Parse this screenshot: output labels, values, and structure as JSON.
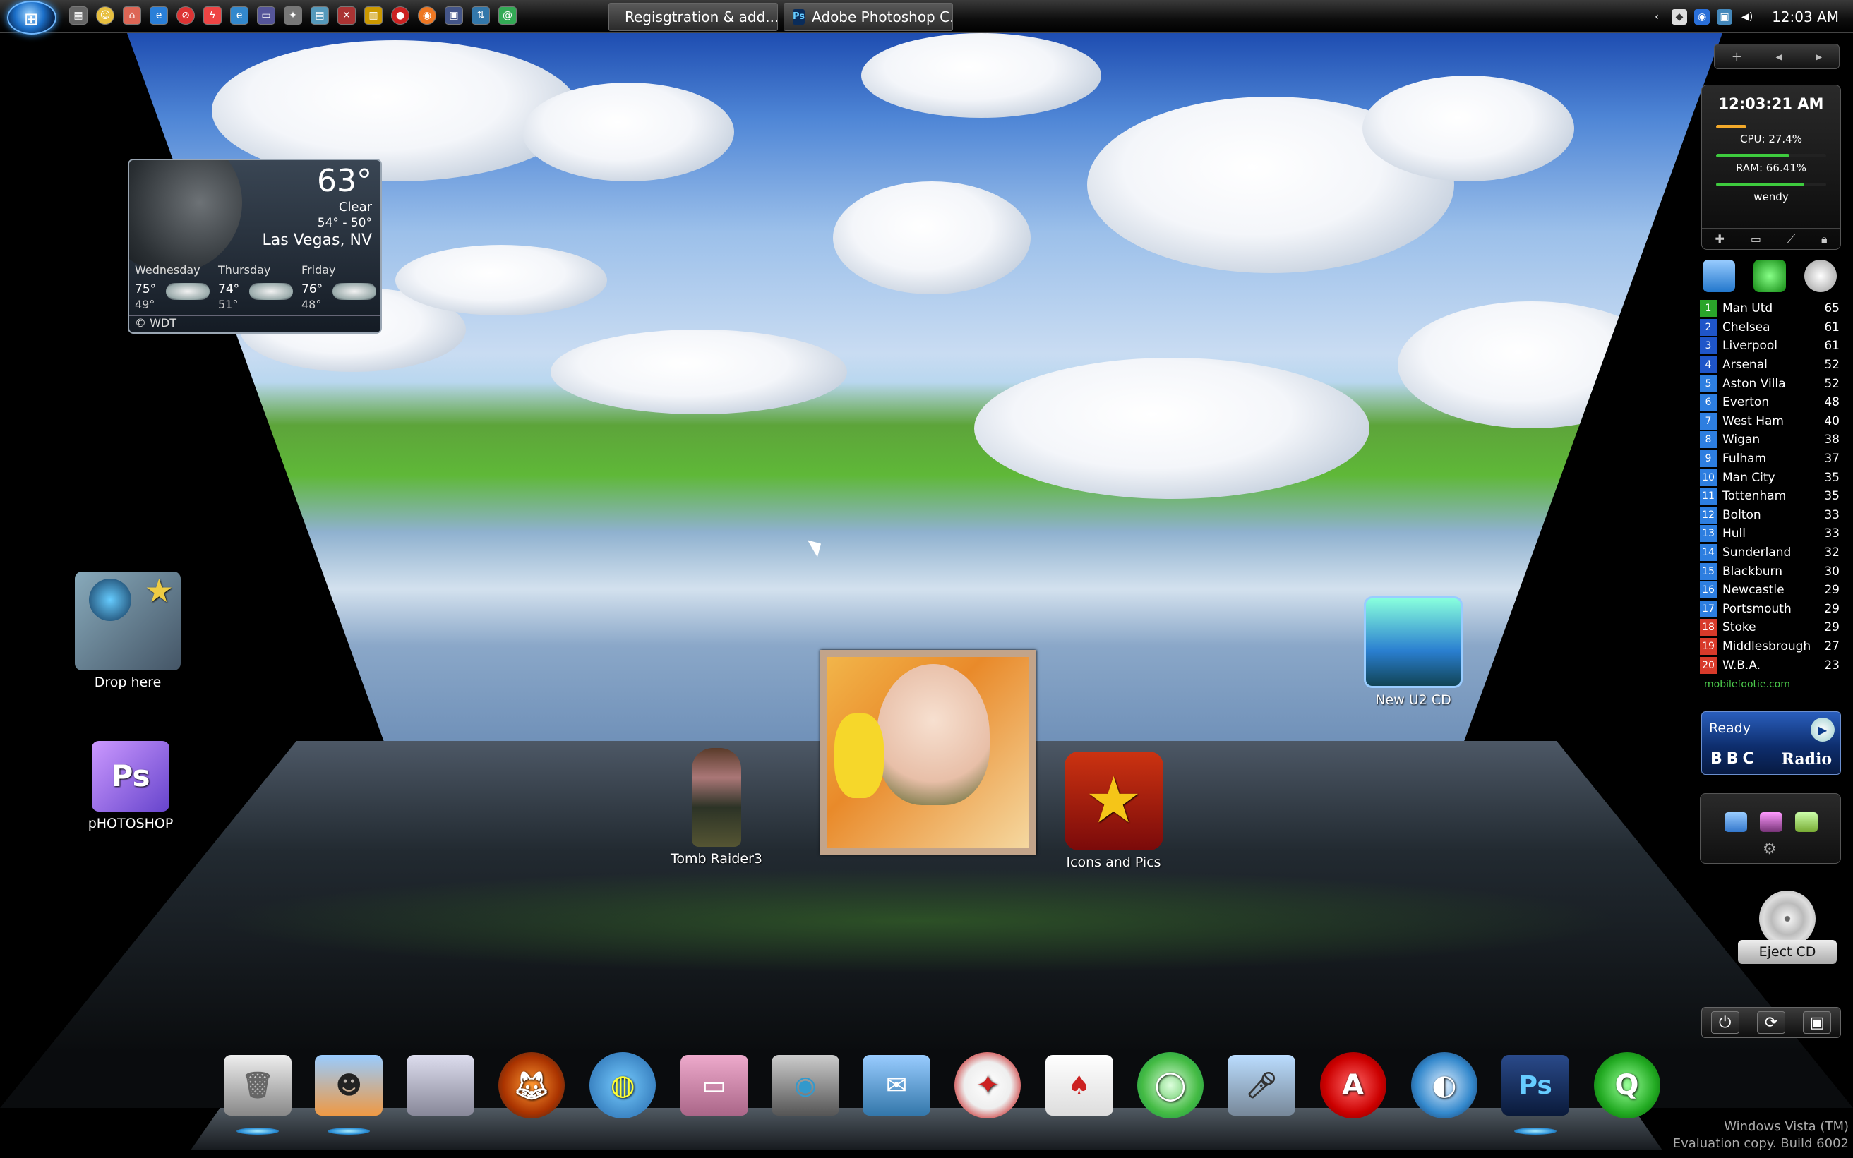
{
  "taskbar": {
    "tasks": [
      {
        "label": "Regisgtration & add...",
        "icon": "document-icon"
      },
      {
        "label": "Adobe Photoshop C...",
        "icon": "photoshop-icon"
      }
    ],
    "clock": "12:03 AM"
  },
  "weather": {
    "temp": "63°",
    "condition": "Clear",
    "range": "54° - 50°",
    "city": "Las Vegas, NV",
    "days": [
      {
        "name": "Wednesday",
        "hi": "75°",
        "lo": "49°"
      },
      {
        "name": "Thursday",
        "hi": "74°",
        "lo": "51°"
      },
      {
        "name": "Friday",
        "hi": "76°",
        "lo": "48°"
      }
    ],
    "credit": "© WDT"
  },
  "desktop_icons": {
    "drop_here": "Drop here",
    "photoshop": "pHOTOSHOP",
    "tomb_raider": "Tomb Raider3",
    "icons_pics": "Icons and Pics",
    "new_u2": "New U2 CD"
  },
  "sysmon": {
    "time": "12:03:21 AM",
    "cpu": "CPU: 27.4%",
    "cpu_fraction": 0.274,
    "ram": "RAM: 66.41%",
    "ram_fraction": 0.6641,
    "user": "wendy"
  },
  "league": {
    "rows": [
      {
        "pos": "1",
        "team": "Man Utd",
        "pts": "65",
        "color": "#2aa52a"
      },
      {
        "pos": "2",
        "team": "Chelsea",
        "pts": "61",
        "color": "#1f55c9"
      },
      {
        "pos": "3",
        "team": "Liverpool",
        "pts": "61",
        "color": "#1f55c9"
      },
      {
        "pos": "4",
        "team": "Arsenal",
        "pts": "52",
        "color": "#1f55c9"
      },
      {
        "pos": "5",
        "team": "Aston Villa",
        "pts": "52",
        "color": "#2d7ee0"
      },
      {
        "pos": "6",
        "team": "Everton",
        "pts": "48",
        "color": "#2d7ee0"
      },
      {
        "pos": "7",
        "team": "West Ham",
        "pts": "40",
        "color": "#2d7ee0"
      },
      {
        "pos": "8",
        "team": "Wigan",
        "pts": "38",
        "color": "#2d7ee0"
      },
      {
        "pos": "9",
        "team": "Fulham",
        "pts": "37",
        "color": "#2d7ee0"
      },
      {
        "pos": "10",
        "team": "Man City",
        "pts": "35",
        "color": "#2d7ee0"
      },
      {
        "pos": "11",
        "team": "Tottenham",
        "pts": "35",
        "color": "#2d7ee0"
      },
      {
        "pos": "12",
        "team": "Bolton",
        "pts": "33",
        "color": "#2d7ee0"
      },
      {
        "pos": "13",
        "team": "Hull",
        "pts": "33",
        "color": "#2d7ee0"
      },
      {
        "pos": "14",
        "team": "Sunderland",
        "pts": "32",
        "color": "#2d7ee0"
      },
      {
        "pos": "15",
        "team": "Blackburn",
        "pts": "30",
        "color": "#2d7ee0"
      },
      {
        "pos": "16",
        "team": "Newcastle",
        "pts": "29",
        "color": "#2d7ee0"
      },
      {
        "pos": "17",
        "team": "Portsmouth",
        "pts": "29",
        "color": "#2d7ee0"
      },
      {
        "pos": "18",
        "team": "Stoke",
        "pts": "29",
        "color": "#d83a2a"
      },
      {
        "pos": "19",
        "team": "Middlesbrough",
        "pts": "27",
        "color": "#d83a2a"
      },
      {
        "pos": "20",
        "team": "W.B.A.",
        "pts": "23",
        "color": "#d83a2a"
      }
    ],
    "credit": "mobilefootie.com"
  },
  "radio": {
    "status": "Ready",
    "brand": "BBC",
    "label": "Radio"
  },
  "eject": {
    "label": "Eject CD"
  },
  "dock": [
    {
      "name": "trash-icon"
    },
    {
      "name": "finder-icon"
    },
    {
      "name": "mac-monitor-icon"
    },
    {
      "name": "firefox-icon"
    },
    {
      "name": "simpsons-globe-icon"
    },
    {
      "name": "wallet-icon"
    },
    {
      "name": "eye-camera-icon"
    },
    {
      "name": "stamp-icon"
    },
    {
      "name": "flame-app-icon"
    },
    {
      "name": "cards-icon"
    },
    {
      "name": "chat-bubble-icon"
    },
    {
      "name": "microphone-icon"
    },
    {
      "name": "red-a-icon"
    },
    {
      "name": "blue-globe-icon"
    },
    {
      "name": "photoshop-dock-icon"
    },
    {
      "name": "quicktime-icon"
    }
  ],
  "watermark": {
    "line1": "Windows Vista (TM)",
    "line2": "Evaluation copy. Build 6002"
  }
}
